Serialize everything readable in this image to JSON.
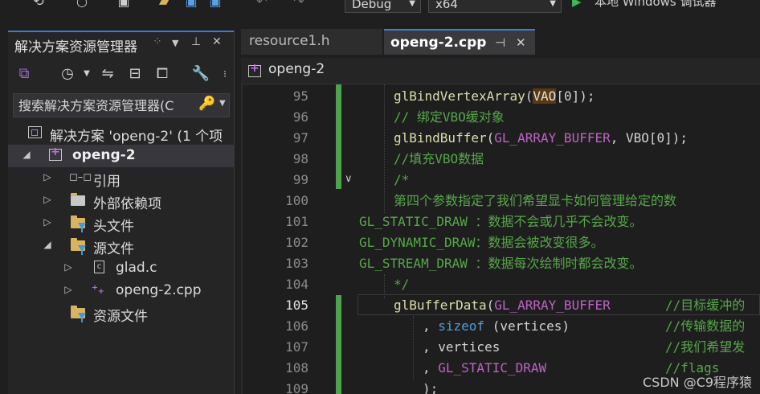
{
  "toolbar": {
    "config_combo": "Debug",
    "platform_combo": "x64",
    "run_label": "本地 Windows 调试器"
  },
  "solution_explorer": {
    "title": "解决方案资源管理器",
    "search_placeholder": "搜索解决方案资源管理器(C",
    "tree": [
      {
        "label": "解决方案 'openg-2' (1 个项",
        "icon": "solution-icon"
      },
      {
        "label": "openg-2",
        "icon": "project-icon",
        "selected": true
      },
      {
        "label": "引用",
        "icon": "references-icon"
      },
      {
        "label": "外部依赖项",
        "icon": "external-deps-icon"
      },
      {
        "label": "头文件",
        "icon": "filter-folder-icon"
      },
      {
        "label": "源文件",
        "icon": "filter-folder-icon"
      },
      {
        "label": "glad.c",
        "icon": "c-file-icon"
      },
      {
        "label": "openg-2.cpp",
        "icon": "cpp-file-icon"
      },
      {
        "label": "资源文件",
        "icon": "filter-folder-icon"
      }
    ]
  },
  "editor": {
    "tabs": [
      {
        "label": "resource1.h",
        "active": false
      },
      {
        "label": "openg-2.cpp",
        "active": true
      }
    ],
    "nav_project": "openg-2",
    "line_numbers": [
      "95",
      "96",
      "97",
      "98",
      "99",
      "100",
      "101",
      "102",
      "103",
      "104",
      "105",
      "106",
      "107",
      "108",
      "109"
    ],
    "current_line": "105",
    "code": {
      "l95": {
        "fn": "glBindVertexArray",
        "p1": "(",
        "hl": "VAO",
        "p2": "[0]);"
      },
      "l96": "// 绑定VBO缓对象",
      "l97": {
        "fn": "glBindBuffer",
        "p1": "(",
        "mac": "GL_ARRAY_BUFFER",
        "p2": ", VBO[0]);"
      },
      "l98": "//填充VBO数据",
      "l99": "/*",
      "l100": "第四个参数指定了我们希望显卡如何管理给定的数",
      "l101": "GL_STATIC_DRAW ：数据不会或几乎不会改变。",
      "l102": "GL_DYNAMIC_DRAW：数据会被改变很多。",
      "l103": "GL_STREAM_DRAW ：数据每次绘制时都会改变。",
      "l104": "*/",
      "l105": {
        "fn": "glBufferData",
        "p1": "(",
        "mac": "GL_ARRAY_BUFFER",
        "cm": "//目标缓冲的"
      },
      "l106": {
        "p1": ", ",
        "kw": "sizeof",
        "p2": " (vertices)",
        "cm": "//传输数据的"
      },
      "l107": {
        "p1": ", vertices",
        "cm": "//我们希望发"
      },
      "l108": {
        "p1": ", ",
        "mac": "GL_STATIC_DRAW",
        "cm": "//flags"
      },
      "l109": {
        "p1": ");"
      }
    }
  },
  "watermark": "CSDN @C9程序猿"
}
